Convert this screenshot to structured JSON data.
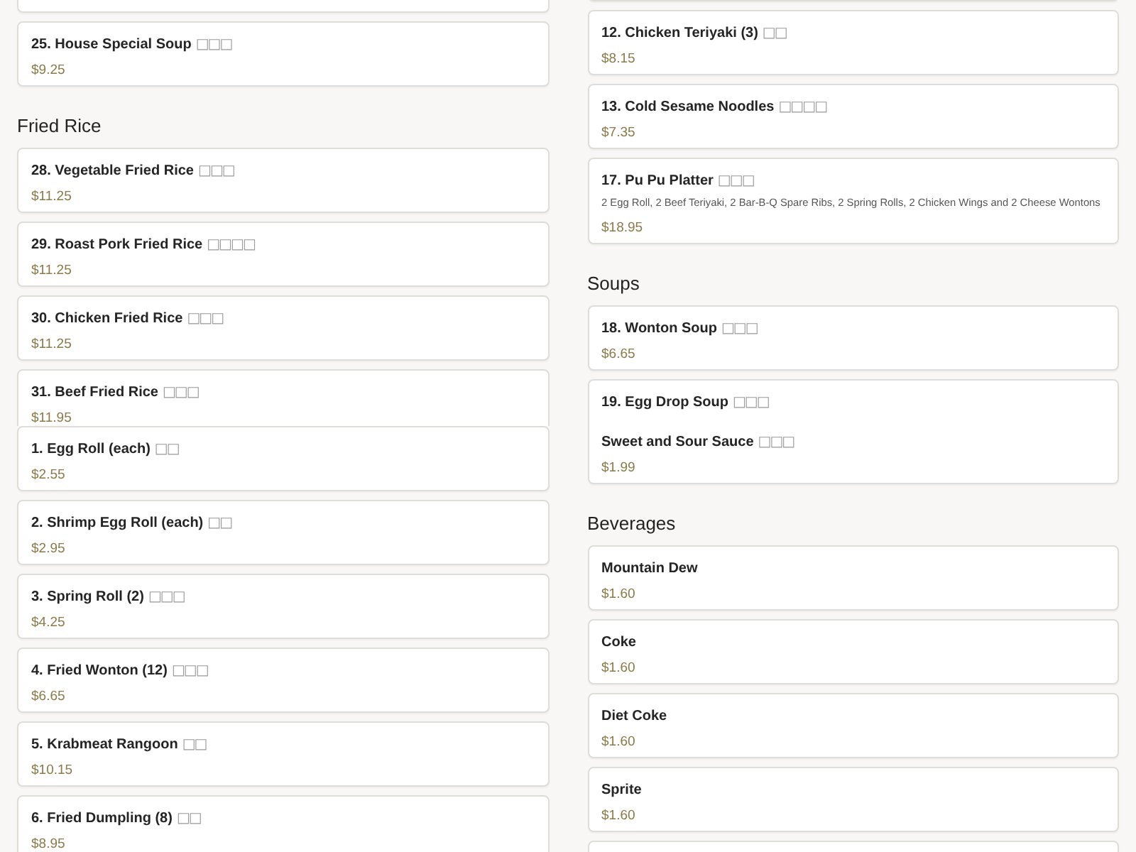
{
  "panels": [
    {
      "columns": [
        {
          "blocks": [
            {
              "kind": "card"
            },
            {
              "kind": "card",
              "name": "25. House Special Soup",
              "chinese": "□□□",
              "price": "$9.25"
            },
            {
              "kind": "heading",
              "text": "Fried Rice"
            },
            {
              "kind": "card",
              "name": "28. Vegetable Fried Rice",
              "chinese": "□□□",
              "price": "$11.25"
            },
            {
              "kind": "card",
              "name": "29. Roast Pork Fried Rice",
              "chinese": "□□□□",
              "price": "$11.25"
            },
            {
              "kind": "card",
              "name": "30. Chicken Fried Rice",
              "chinese": "□□□",
              "price": "$11.25"
            },
            {
              "kind": "card",
              "name": "31. Beef Fried Rice",
              "chinese": "□□□",
              "price": "$11.95"
            }
          ]
        },
        {
          "blocks": [
            {
              "kind": "card"
            },
            {
              "kind": "card",
              "name": "12. Chicken Teriyaki (3)",
              "chinese": "□□",
              "price": "$8.15"
            },
            {
              "kind": "card",
              "name": "13. Cold Sesame Noodles",
              "chinese": "□□□□",
              "price": "$7.35"
            },
            {
              "kind": "card",
              "name": "17. Pu Pu Platter",
              "chinese": "□□□",
              "description": "2 Egg Roll, 2 Beef Teriyaki, 2 Bar-B-Q Spare Ribs, 2 Spring Rolls, 2 Chicken Wings and 2 Cheese Wontons",
              "price": "$18.95"
            },
            {
              "kind": "heading",
              "text": "Soups"
            },
            {
              "kind": "card",
              "name": "18. Wonton Soup",
              "chinese": "□□□",
              "price": "$6.65"
            },
            {
              "kind": "card",
              "name": "19. Egg Drop Soup",
              "chinese": "□□□"
            }
          ]
        }
      ]
    },
    {
      "columns": [
        {
          "blocks": [
            {
              "kind": "card",
              "name": "1. Egg Roll (each)",
              "chinese": "□□",
              "price": "$2.55"
            },
            {
              "kind": "card",
              "name": "2. Shrimp Egg Roll (each)",
              "chinese": "□□",
              "price": "$2.95"
            },
            {
              "kind": "card",
              "name": "3. Spring Roll (2)",
              "chinese": "□□□",
              "price": "$4.25"
            },
            {
              "kind": "card",
              "name": "4. Fried Wonton (12)",
              "chinese": "□□□",
              "price": "$6.65"
            },
            {
              "kind": "card",
              "name": "5. Krabmeat Rangoon",
              "chinese": "□□",
              "price": "$10.15"
            },
            {
              "kind": "card",
              "name": "6. Fried Dumpling (8)",
              "chinese": "□□",
              "price": "$8.95"
            }
          ]
        },
        {
          "blocks": [
            {
              "kind": "card",
              "name": "Sweet and Sour Sauce",
              "chinese": "□□□",
              "price": "$1.99"
            },
            {
              "kind": "heading",
              "text": "Beverages"
            },
            {
              "kind": "card",
              "name": "Mountain Dew",
              "price": "$1.60"
            },
            {
              "kind": "card",
              "name": "Coke",
              "price": "$1.60"
            },
            {
              "kind": "card",
              "name": "Diet Coke",
              "price": "$1.60"
            },
            {
              "kind": "card",
              "name": "Sprite",
              "price": "$1.60"
            },
            {
              "kind": "card"
            }
          ]
        }
      ]
    }
  ]
}
